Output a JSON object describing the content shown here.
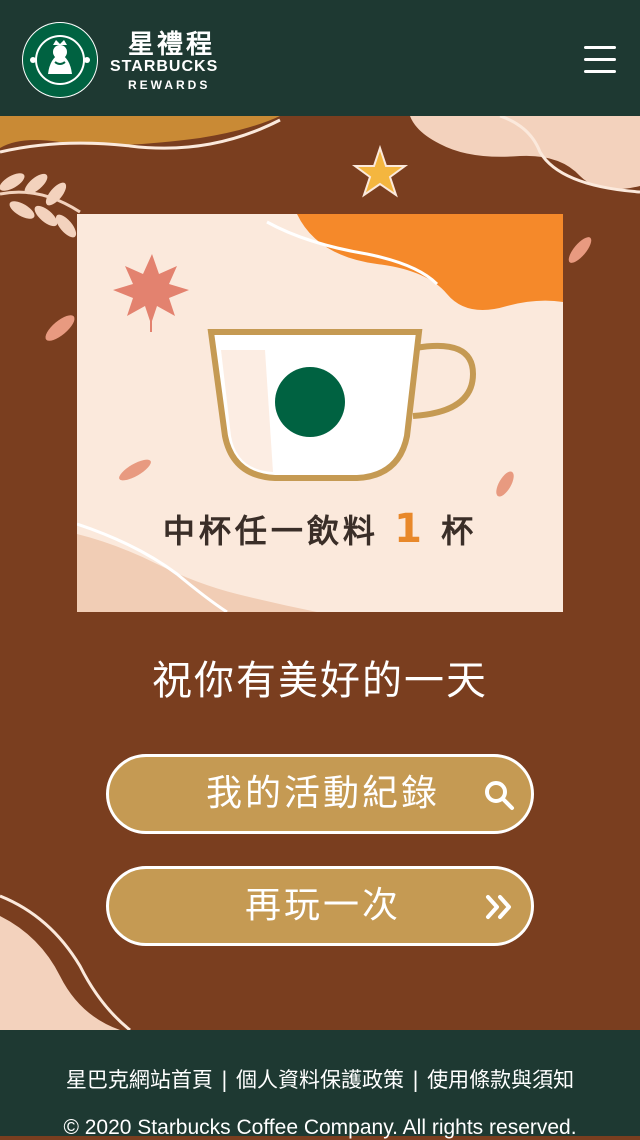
{
  "header": {
    "brand_cn": "星禮程",
    "brand_en": "STARBUCKS",
    "brand_sub": "REWARDS",
    "logo_icon": "starbucks-siren-logo-icon",
    "menu_icon": "hamburger-menu-icon"
  },
  "card": {
    "text_prefix": "中杯任一飲料",
    "quantity": "1",
    "text_suffix": "杯"
  },
  "greeting": "祝你有美好的一天",
  "buttons": {
    "history_label": "我的活動紀錄",
    "history_icon": "search-icon",
    "replay_label": "再玩一次",
    "replay_icon": "double-chevron-right-icon"
  },
  "footer": {
    "links": [
      "星巴克網站首頁",
      "個人資料保護政策",
      "使用條款與須知"
    ],
    "separator": "|",
    "copyright": "© 2020 Starbucks Coffee Company. All rights reserved."
  },
  "colors": {
    "brand_green": "#1e3932",
    "background_brown": "#7a3e1f",
    "button_gold": "#c59a53",
    "card_cream": "#fbe9dc",
    "accent_orange": "#f5892a"
  }
}
